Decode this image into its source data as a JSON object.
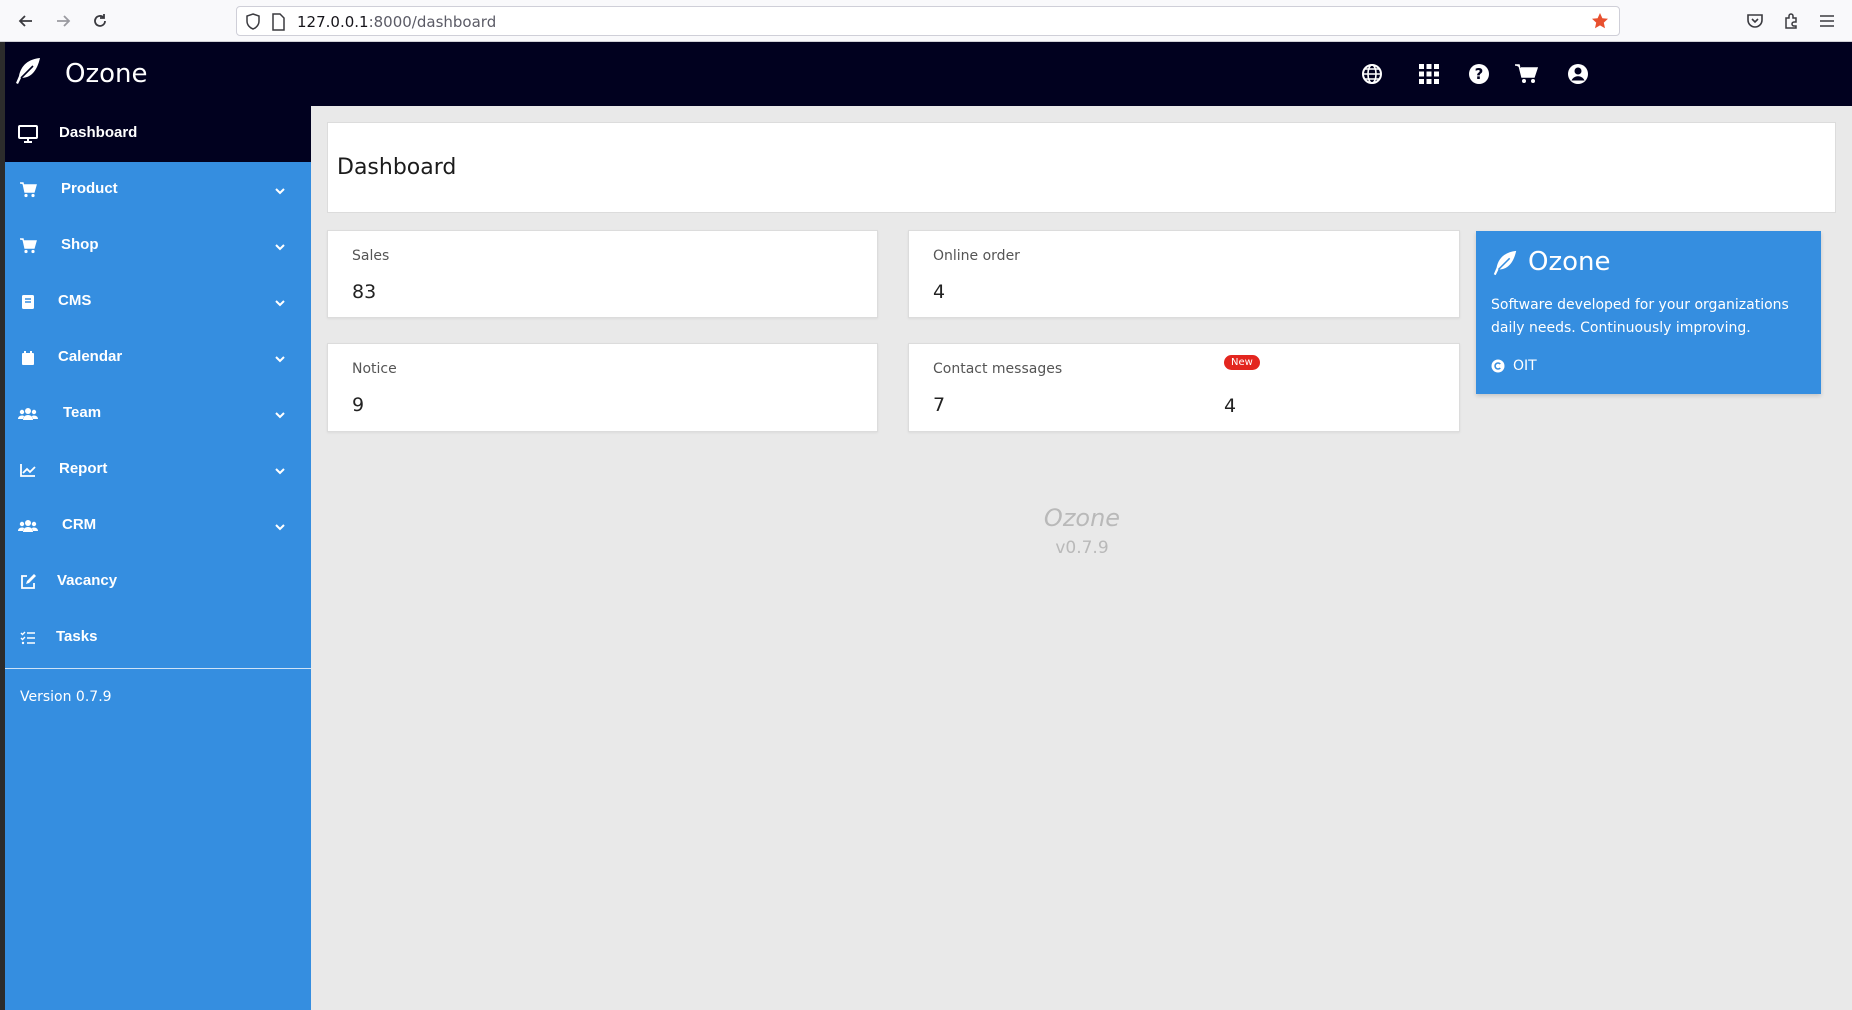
{
  "browser": {
    "url_host": "127.0.0.1",
    "url_rest": ":8000/dashboard",
    "icons": [
      "back-arrow-icon",
      "forward-arrow-icon",
      "reload-icon",
      "shield-icon",
      "page-icon",
      "bookmark-star-icon",
      "pocket-icon",
      "extensions-icon",
      "menu-icon"
    ]
  },
  "header": {
    "brand": "Ozone",
    "icons": [
      "globe-icon",
      "apps-grid-icon",
      "help-icon",
      "cart-icon",
      "user-icon"
    ]
  },
  "sidebar": {
    "items": [
      {
        "label": "Dashboard",
        "icon": "monitor-icon",
        "active": true,
        "has_children": false
      },
      {
        "label": "Product",
        "icon": "cart-icon",
        "has_children": true
      },
      {
        "label": "Shop",
        "icon": "cart-icon",
        "has_children": true
      },
      {
        "label": "CMS",
        "icon": "book-icon",
        "has_children": true
      },
      {
        "label": "Calendar",
        "icon": "calendar-icon",
        "has_children": true
      },
      {
        "label": "Team",
        "icon": "users-icon",
        "has_children": true
      },
      {
        "label": "Report",
        "icon": "chart-icon",
        "has_children": true
      },
      {
        "label": "CRM",
        "icon": "users-icon",
        "has_children": true
      },
      {
        "label": "Vacancy",
        "icon": "edit-icon",
        "has_children": false
      },
      {
        "label": "Tasks",
        "icon": "tasks-icon",
        "has_children": false
      }
    ],
    "version": "Version 0.7.9"
  },
  "main": {
    "title": "Dashboard",
    "cards": {
      "sales": {
        "label": "Sales",
        "value": "83"
      },
      "online_order": {
        "label": "Online order",
        "value": "4"
      },
      "notice": {
        "label": "Notice",
        "value": "9"
      },
      "contact": {
        "label": "Contact messages",
        "value": "7",
        "new_badge": "New",
        "new_value": "4"
      }
    },
    "info": {
      "title": "Ozone",
      "description": "Software developed for your organizations daily needs. Continuously improving.",
      "link": "OIT"
    },
    "footer": {
      "name": "Ozone",
      "version": "v0.7.9"
    }
  },
  "colors": {
    "sidebar": "#358ee0",
    "header": "#01011f",
    "badge": "#e3261f",
    "background": "#e9e9e9"
  }
}
